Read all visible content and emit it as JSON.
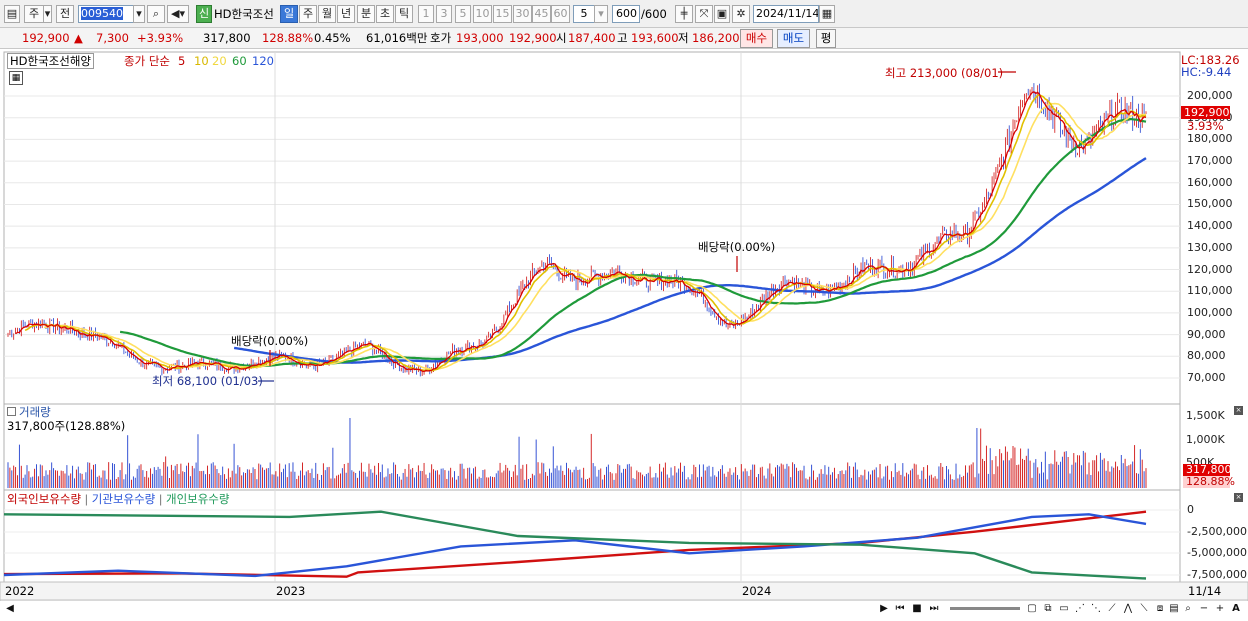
{
  "toolbar": {
    "period_short": "주",
    "prev": "전",
    "stock_code": "009540",
    "new_badge": "신",
    "stock_name": "HD한국조선",
    "tabs": [
      "일",
      "주",
      "월",
      "년",
      "분",
      "초",
      "틱"
    ],
    "active_tab": "일",
    "numbers": [
      "1",
      "3",
      "5",
      "10",
      "15",
      "30",
      "45",
      "60"
    ],
    "select_value": "5",
    "count": "600",
    "count_total": "/600",
    "date": "2024/11/14"
  },
  "info": {
    "price": "192,900",
    "arrow": "▲",
    "change": "7,300",
    "change_pct": "+3.93%",
    "volume": "317,800",
    "volume_pct": "128.88%",
    "turnover": "0.45%",
    "amount": "61,016백만",
    "quote_label": "호가",
    "ask": "193,000",
    "bid": "192,900",
    "open_label": "시",
    "open": "187,400",
    "high_label": "고",
    "high": "193,600",
    "low_label": "저",
    "low": "186,200",
    "buy": "매수",
    "sell": "매도",
    "flat": "평"
  },
  "price_panel": {
    "legend_name": "HD한국조선해양",
    "legend_ma": "종가 단순",
    "ma_periods": [
      "5",
      "10",
      "20",
      "60",
      "120"
    ],
    "ma_colors": [
      "#d80000",
      "#e0c000",
      "#ffe060",
      "#1f9a3a",
      "#2a55d8"
    ],
    "lc": "LC:183.26",
    "hc": "HC:-9.44",
    "current_price": "192,900",
    "current_pct": "3.93%",
    "annotation_high": "최고 213,000 (08/01)",
    "annotation_low": "최저 68,100 (01/03)",
    "dividend_1": "배당락(0.00%)",
    "dividend_2": "배당락(0.00%)",
    "scale": [
      "200,000",
      "190,000",
      "180,000",
      "170,000",
      "160,000",
      "150,000",
      "140,000",
      "130,000",
      "120,000",
      "110,000",
      "100,000",
      "90,000",
      "80,000",
      "70,000"
    ]
  },
  "volume_panel": {
    "title": "거래량",
    "value": "317,800주(128.88%)",
    "scale": [
      "1,500K",
      "1,000K",
      "500K"
    ],
    "current": "317,800",
    "current_pct": "128.88%"
  },
  "holder_panel": {
    "foreign": "외국인보유수량",
    "institution": "기관보유수량",
    "individual": "개인보유수량",
    "scale": [
      "0",
      "-2,500,000",
      "-5,000,000",
      "-7,500,000"
    ]
  },
  "xaxis": [
    "2022",
    "2023",
    "2024"
  ],
  "xaxis_end": "11/14",
  "chart_data": {
    "type": "candlestick",
    "period": "daily",
    "count": 600,
    "last_date": "2024/11/14",
    "close": 192900,
    "high_point": {
      "value": 213000,
      "date": "08/01"
    },
    "low_point": {
      "value": 68100,
      "date": "01/03"
    },
    "price_trend": [
      [
        "2022",
        90000
      ],
      [
        "2022",
        96000
      ],
      [
        "2022",
        80000
      ],
      [
        "2022",
        74000
      ],
      [
        "2023",
        78000
      ],
      [
        "2023",
        77000
      ],
      [
        "2023",
        83000
      ],
      [
        "2023",
        73000
      ],
      [
        "2023",
        90000
      ],
      [
        "2023",
        122000
      ],
      [
        "2023",
        115000
      ],
      [
        "2023",
        118000
      ],
      [
        "2024",
        95000
      ],
      [
        "2024",
        112000
      ],
      [
        "2024",
        114000
      ],
      [
        "2024",
        125000
      ],
      [
        "2024",
        135000
      ],
      [
        "2024",
        200000
      ],
      [
        "2024",
        180000
      ],
      [
        "2024",
        192900
      ]
    ],
    "ma120_trend": [
      [
        0.25,
        81000
      ],
      [
        0.5,
        82000
      ],
      [
        0.62,
        106000
      ],
      [
        0.75,
        112000
      ],
      [
        0.85,
        125000
      ],
      [
        0.92,
        155000
      ],
      [
        1.0,
        175000
      ]
    ],
    "volume_last": 317800,
    "volume_max_label": "1,500K",
    "ylim_price": [
      62000,
      216000
    ]
  }
}
